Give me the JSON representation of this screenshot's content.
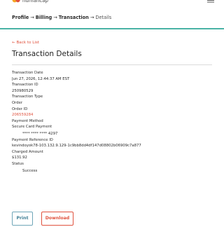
{
  "header": {
    "brand_name": "humancap",
    "logo_color_primary": "#f5a623",
    "logo_color_secondary": "#e0523e",
    "menu_icon": "hamburger-menu-icon"
  },
  "breadcrumb": {
    "items": [
      "Profile",
      "Billing",
      "Transaction"
    ],
    "current": "Details",
    "separator": "→"
  },
  "back_link": "← Back to List",
  "page_title": "Transaction Details",
  "details": {
    "transaction_date_label": "Transaction Date",
    "transaction_date_value": "Jun 27, 2026, 12:44:37 AM EST",
    "transaction_id_label": "Transaction ID",
    "transaction_id_value": "250980529",
    "transaction_type_label": "Transaction Type",
    "transaction_type_value": "Order",
    "order_id_label": "Order ID",
    "order_id_value": "206559284",
    "payment_method_label": "Payment Method",
    "payment_method_value": "Secure Card Payment",
    "card_number_masked": "**** **** **** 4297",
    "payment_reference_label": "Payment Reference ID",
    "payment_reference_value": "kevindoyok78-103.132.9.129-1c9bb8dd4df147d08802b06909c7a877",
    "charged_amount_label": "Charged Amount",
    "charged_amount_value": "$131.92",
    "status_label": "Status",
    "status_value": "Success"
  },
  "actions": {
    "print_label": "Print",
    "download_label": "Download"
  },
  "colors": {
    "accent_teal": "#4ab3a5",
    "link_red": "#e0523e",
    "print_blue": "#3f7f96"
  }
}
